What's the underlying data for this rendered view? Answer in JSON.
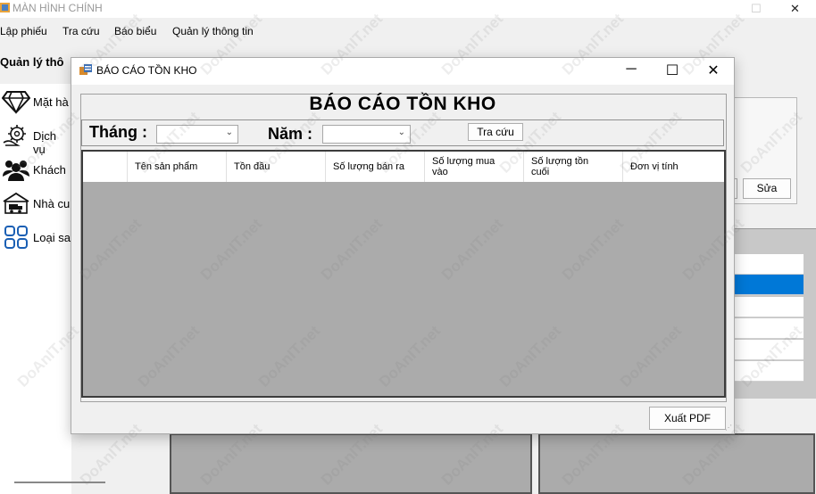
{
  "main_window": {
    "title": "MÀN HÌNH CHÍNH",
    "menu": [
      "Lập phiếu",
      "Tra cứu",
      "Báo biểu",
      "Quản lý thông tin"
    ],
    "sidebar_heading": "Quản lý thô",
    "sidebar_items": [
      {
        "label": "Mặt hà",
        "icon": "diamond-icon"
      },
      {
        "label": "Dịch vụ",
        "icon": "service-gear-icon"
      },
      {
        "label": "Khách",
        "icon": "customers-icon"
      },
      {
        "label": "Nhà cu",
        "icon": "supplier-truck-icon"
      },
      {
        "label": "Loại sa",
        "icon": "category-grid-icon"
      }
    ],
    "edit_button": "Sửa"
  },
  "dialog": {
    "title": "BÁO CÁO TỒN KHO",
    "heading": "BÁO CÁO TỒN KHO",
    "month_label": "Tháng :",
    "month_value": "",
    "year_label": "Năm :",
    "year_value": "",
    "search_button": "Tra cứu",
    "columns": [
      [
        "Tên sản phẩm"
      ],
      [
        "Tồn đầu"
      ],
      [
        "Số lượng bán ra"
      ],
      [
        "Số lượng mua",
        "vào"
      ],
      [
        "Số lượng tồn",
        "cuối"
      ],
      [
        "Đơn vị tính"
      ]
    ],
    "export_button": "Xuất PDF",
    "window_controls": {
      "minimize": "─",
      "maximize": "☐",
      "close": "✕"
    }
  },
  "watermark": "DoAnIT.net",
  "colors": {
    "selection": "#0078d7",
    "grid_background": "#ababab"
  }
}
